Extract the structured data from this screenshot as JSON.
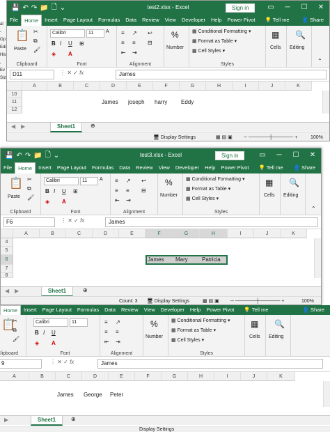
{
  "ribbon": {
    "tabs_main": [
      "File",
      "Home",
      "Insert",
      "Page Layout",
      "Formulas",
      "Data",
      "Review",
      "View",
      "Developer",
      "Help",
      "Power Pivot"
    ],
    "tell_me": "Tell me",
    "share": "Share",
    "paste": "Paste",
    "font_name": "Calibri",
    "font_size": "11",
    "number": "Number",
    "conditional_formatting": "Conditional Formatting",
    "format_as_table": "Format as Table",
    "cell_styles": "Cell Styles",
    "cells": "Cells",
    "editing": "Editing",
    "groups": {
      "clipboard": "Clipboard",
      "font": "Font",
      "alignment": "Alignment",
      "styles": "Styles"
    }
  },
  "win1": {
    "title": "test2.xlsx  -  Excel",
    "sign_in": "Sign in",
    "name_box": "D11",
    "formula": "James",
    "columns": [
      "A",
      "B",
      "C",
      "D",
      "E",
      "F",
      "G",
      "H",
      "I",
      "J",
      "K"
    ],
    "rows": [
      "10",
      "11",
      "12"
    ],
    "cells": {
      "d11": "James",
      "e11": "joseph",
      "f11": "harry",
      "g11": "Eddy"
    },
    "sheet": "Sheet1",
    "status": "Display Settings",
    "zoom": "100%",
    "side": [
      "al",
      "-Op",
      "Edi",
      "His",
      ", Ev",
      "Size"
    ]
  },
  "win2": {
    "title": "test3.xlsx  -  Excel",
    "sign_in": "Sign in",
    "name_box": "F6",
    "formula": "James",
    "columns": [
      "A",
      "B",
      "C",
      "D",
      "E",
      "F",
      "G",
      "H",
      "I",
      "J",
      "K"
    ],
    "rows": [
      "4",
      "5",
      "6",
      "7",
      "8"
    ],
    "cells": {
      "f6": "James",
      "g6": "Mary",
      "h6": "Patricia"
    },
    "sheet": "Sheet1",
    "count": "Count: 3",
    "status": "Display Settings",
    "zoom": "100%"
  },
  "win3": {
    "tabs": [
      "Home",
      "Insert",
      "Page Layout",
      "Formulas",
      "Data",
      "Review",
      "View",
      "Developer",
      "Help",
      "Power Pivot"
    ],
    "tell_me": "Tell me",
    "share": "Share",
    "name_box": "9",
    "formula": "James",
    "columns": [
      "A",
      "B",
      "C",
      "D",
      "E",
      "F",
      "G",
      "H",
      "I",
      "J",
      "K"
    ],
    "cells": {
      "c": "James",
      "d": "George",
      "e": "Peter"
    },
    "sheet": "Sheet1",
    "status": "Display Settings"
  },
  "colors": {
    "excel_green": "#217346",
    "ribbon_bg": "#f3f3f3",
    "selection": "#d0d0d0"
  }
}
